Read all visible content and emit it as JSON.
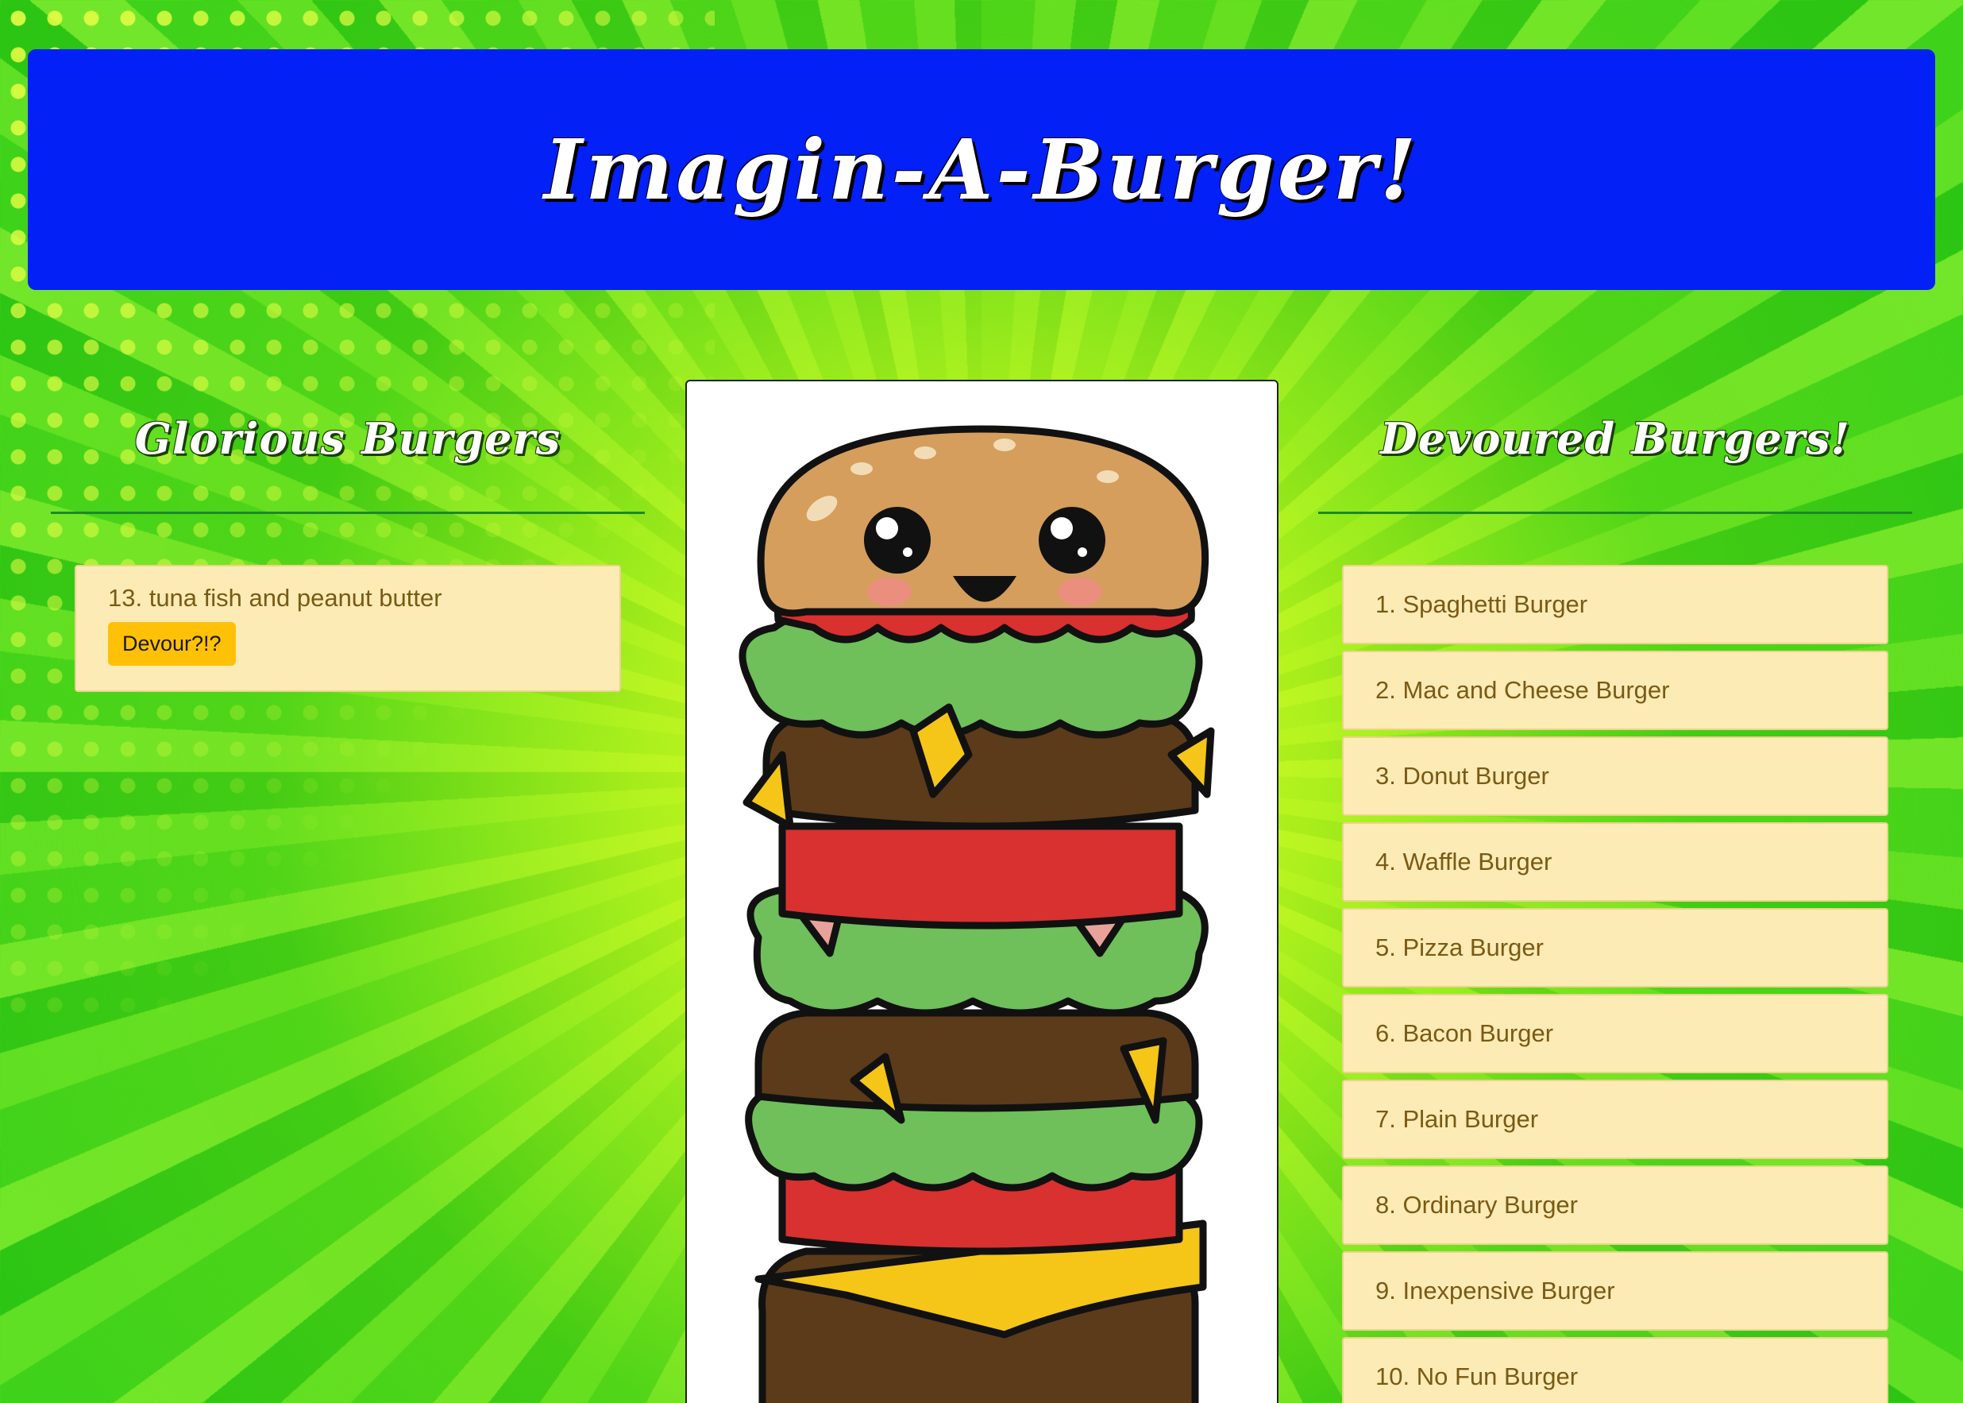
{
  "header": {
    "title": "Imagin-A-Burger!"
  },
  "left_column": {
    "title": "Glorious Burgers",
    "items": [
      {
        "label": "13. tuna fish and peanut butter",
        "button_label": "Devour?!?"
      }
    ]
  },
  "right_column": {
    "title": "Devoured Burgers!",
    "items": [
      "1. Spaghetti Burger",
      "2. Mac and Cheese Burger",
      "3. Donut Burger",
      "4. Waffle Burger",
      "5. Pizza Burger",
      "6. Bacon Burger",
      "7. Plain Burger",
      "8. Ordinary Burger",
      "9. Inexpensive Burger",
      "10. No Fun Burger"
    ]
  },
  "colors": {
    "header_bg": "#0320f7",
    "card_bg": "#fdebb5",
    "card_text": "#7a5a14",
    "button_bg": "#ffc107",
    "background_green": "#4fd61d"
  },
  "center_image": {
    "icon": "kawaii-burger-illustration"
  }
}
